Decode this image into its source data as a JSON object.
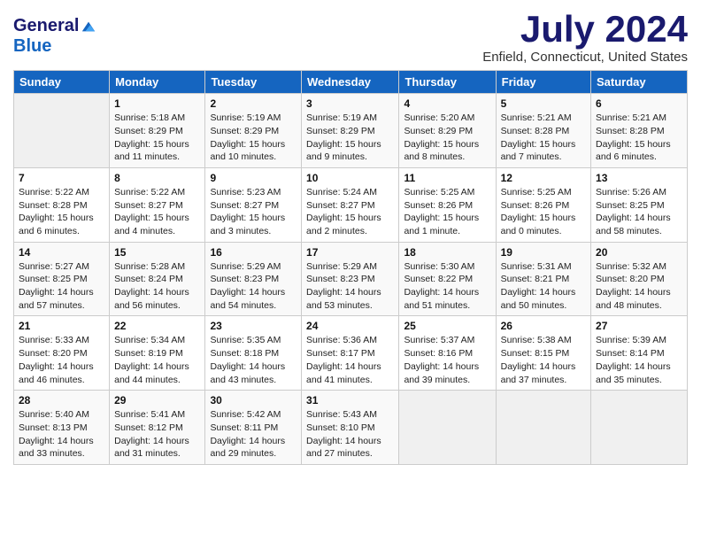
{
  "header": {
    "logo_general": "General",
    "logo_blue": "Blue",
    "title": "July 2024",
    "location": "Enfield, Connecticut, United States"
  },
  "days_of_week": [
    "Sunday",
    "Monday",
    "Tuesday",
    "Wednesday",
    "Thursday",
    "Friday",
    "Saturday"
  ],
  "weeks": [
    [
      {
        "day": "",
        "sunrise": "",
        "sunset": "",
        "daylight": ""
      },
      {
        "day": "1",
        "sunrise": "Sunrise: 5:18 AM",
        "sunset": "Sunset: 8:29 PM",
        "daylight": "Daylight: 15 hours and 11 minutes."
      },
      {
        "day": "2",
        "sunrise": "Sunrise: 5:19 AM",
        "sunset": "Sunset: 8:29 PM",
        "daylight": "Daylight: 15 hours and 10 minutes."
      },
      {
        "day": "3",
        "sunrise": "Sunrise: 5:19 AM",
        "sunset": "Sunset: 8:29 PM",
        "daylight": "Daylight: 15 hours and 9 minutes."
      },
      {
        "day": "4",
        "sunrise": "Sunrise: 5:20 AM",
        "sunset": "Sunset: 8:29 PM",
        "daylight": "Daylight: 15 hours and 8 minutes."
      },
      {
        "day": "5",
        "sunrise": "Sunrise: 5:21 AM",
        "sunset": "Sunset: 8:28 PM",
        "daylight": "Daylight: 15 hours and 7 minutes."
      },
      {
        "day": "6",
        "sunrise": "Sunrise: 5:21 AM",
        "sunset": "Sunset: 8:28 PM",
        "daylight": "Daylight: 15 hours and 6 minutes."
      }
    ],
    [
      {
        "day": "7",
        "sunrise": "Sunrise: 5:22 AM",
        "sunset": "Sunset: 8:28 PM",
        "daylight": "Daylight: 15 hours and 6 minutes."
      },
      {
        "day": "8",
        "sunrise": "Sunrise: 5:22 AM",
        "sunset": "Sunset: 8:27 PM",
        "daylight": "Daylight: 15 hours and 4 minutes."
      },
      {
        "day": "9",
        "sunrise": "Sunrise: 5:23 AM",
        "sunset": "Sunset: 8:27 PM",
        "daylight": "Daylight: 15 hours and 3 minutes."
      },
      {
        "day": "10",
        "sunrise": "Sunrise: 5:24 AM",
        "sunset": "Sunset: 8:27 PM",
        "daylight": "Daylight: 15 hours and 2 minutes."
      },
      {
        "day": "11",
        "sunrise": "Sunrise: 5:25 AM",
        "sunset": "Sunset: 8:26 PM",
        "daylight": "Daylight: 15 hours and 1 minute."
      },
      {
        "day": "12",
        "sunrise": "Sunrise: 5:25 AM",
        "sunset": "Sunset: 8:26 PM",
        "daylight": "Daylight: 15 hours and 0 minutes."
      },
      {
        "day": "13",
        "sunrise": "Sunrise: 5:26 AM",
        "sunset": "Sunset: 8:25 PM",
        "daylight": "Daylight: 14 hours and 58 minutes."
      }
    ],
    [
      {
        "day": "14",
        "sunrise": "Sunrise: 5:27 AM",
        "sunset": "Sunset: 8:25 PM",
        "daylight": "Daylight: 14 hours and 57 minutes."
      },
      {
        "day": "15",
        "sunrise": "Sunrise: 5:28 AM",
        "sunset": "Sunset: 8:24 PM",
        "daylight": "Daylight: 14 hours and 56 minutes."
      },
      {
        "day": "16",
        "sunrise": "Sunrise: 5:29 AM",
        "sunset": "Sunset: 8:23 PM",
        "daylight": "Daylight: 14 hours and 54 minutes."
      },
      {
        "day": "17",
        "sunrise": "Sunrise: 5:29 AM",
        "sunset": "Sunset: 8:23 PM",
        "daylight": "Daylight: 14 hours and 53 minutes."
      },
      {
        "day": "18",
        "sunrise": "Sunrise: 5:30 AM",
        "sunset": "Sunset: 8:22 PM",
        "daylight": "Daylight: 14 hours and 51 minutes."
      },
      {
        "day": "19",
        "sunrise": "Sunrise: 5:31 AM",
        "sunset": "Sunset: 8:21 PM",
        "daylight": "Daylight: 14 hours and 50 minutes."
      },
      {
        "day": "20",
        "sunrise": "Sunrise: 5:32 AM",
        "sunset": "Sunset: 8:20 PM",
        "daylight": "Daylight: 14 hours and 48 minutes."
      }
    ],
    [
      {
        "day": "21",
        "sunrise": "Sunrise: 5:33 AM",
        "sunset": "Sunset: 8:20 PM",
        "daylight": "Daylight: 14 hours and 46 minutes."
      },
      {
        "day": "22",
        "sunrise": "Sunrise: 5:34 AM",
        "sunset": "Sunset: 8:19 PM",
        "daylight": "Daylight: 14 hours and 44 minutes."
      },
      {
        "day": "23",
        "sunrise": "Sunrise: 5:35 AM",
        "sunset": "Sunset: 8:18 PM",
        "daylight": "Daylight: 14 hours and 43 minutes."
      },
      {
        "day": "24",
        "sunrise": "Sunrise: 5:36 AM",
        "sunset": "Sunset: 8:17 PM",
        "daylight": "Daylight: 14 hours and 41 minutes."
      },
      {
        "day": "25",
        "sunrise": "Sunrise: 5:37 AM",
        "sunset": "Sunset: 8:16 PM",
        "daylight": "Daylight: 14 hours and 39 minutes."
      },
      {
        "day": "26",
        "sunrise": "Sunrise: 5:38 AM",
        "sunset": "Sunset: 8:15 PM",
        "daylight": "Daylight: 14 hours and 37 minutes."
      },
      {
        "day": "27",
        "sunrise": "Sunrise: 5:39 AM",
        "sunset": "Sunset: 8:14 PM",
        "daylight": "Daylight: 14 hours and 35 minutes."
      }
    ],
    [
      {
        "day": "28",
        "sunrise": "Sunrise: 5:40 AM",
        "sunset": "Sunset: 8:13 PM",
        "daylight": "Daylight: 14 hours and 33 minutes."
      },
      {
        "day": "29",
        "sunrise": "Sunrise: 5:41 AM",
        "sunset": "Sunset: 8:12 PM",
        "daylight": "Daylight: 14 hours and 31 minutes."
      },
      {
        "day": "30",
        "sunrise": "Sunrise: 5:42 AM",
        "sunset": "Sunset: 8:11 PM",
        "daylight": "Daylight: 14 hours and 29 minutes."
      },
      {
        "day": "31",
        "sunrise": "Sunrise: 5:43 AM",
        "sunset": "Sunset: 8:10 PM",
        "daylight": "Daylight: 14 hours and 27 minutes."
      },
      {
        "day": "",
        "sunrise": "",
        "sunset": "",
        "daylight": ""
      },
      {
        "day": "",
        "sunrise": "",
        "sunset": "",
        "daylight": ""
      },
      {
        "day": "",
        "sunrise": "",
        "sunset": "",
        "daylight": ""
      }
    ]
  ]
}
